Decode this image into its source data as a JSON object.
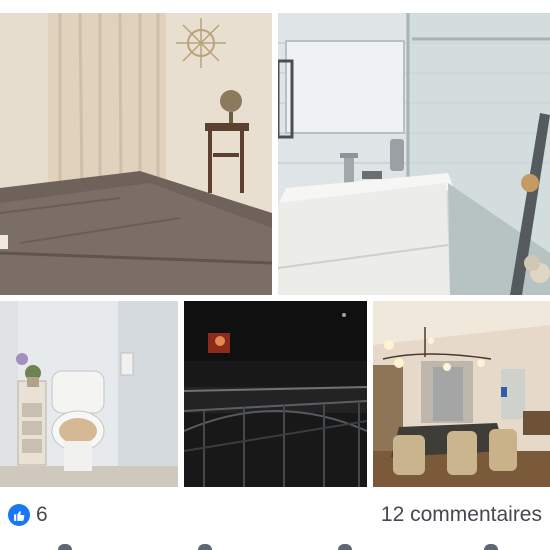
{
  "post": {
    "photos": [
      {
        "subject": "bedroom"
      },
      {
        "subject": "bathroom"
      },
      {
        "subject": "toilet"
      },
      {
        "subject": "balcony-night"
      },
      {
        "subject": "dining-room"
      }
    ]
  },
  "footer": {
    "reaction_icon": "like-icon",
    "reaction_count": "6",
    "comments_label": "12 commentaires"
  },
  "colors": {
    "like_blue": "#1877f2",
    "count_text": "#444950"
  }
}
